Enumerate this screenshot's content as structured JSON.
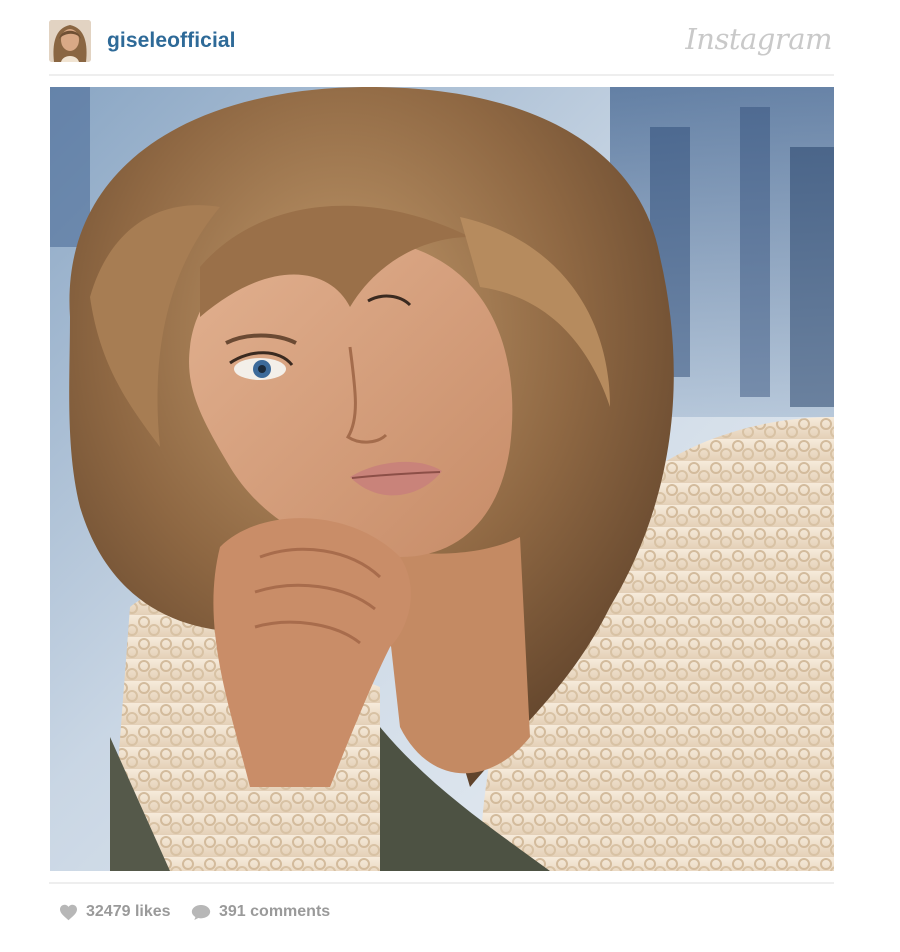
{
  "post": {
    "username": "giseleofficial",
    "brand": "Instagram",
    "likes_count": "32479",
    "likes_label": "likes",
    "comments_count": "391",
    "comments_label": "comments"
  },
  "colors": {
    "username": "#2e6a98",
    "meta_text": "#9a9a9a",
    "brand": "#c9c9c9",
    "divider": "#eeeeee"
  },
  "icons": {
    "likes": "heart-icon",
    "comments": "speech-bubble-icon"
  }
}
